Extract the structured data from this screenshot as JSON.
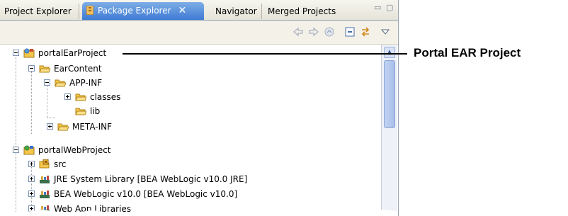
{
  "tabs": [
    {
      "label": "Project Explorer",
      "active": false
    },
    {
      "label": "Package Explorer",
      "active": true
    },
    {
      "label": "Navigator",
      "active": false
    },
    {
      "label": "Merged Projects",
      "active": false
    }
  ],
  "tab_close_glyph": "✕",
  "window_controls": {
    "minimize": "▭",
    "maximize": "▢"
  },
  "toolbar_icons": [
    "back-arrow-icon",
    "forward-arrow-icon",
    "home-icon",
    "collapse-all-icon",
    "link-with-editor-icon",
    "view-menu-icon"
  ],
  "tree": [
    {
      "label": "portalEarProject",
      "icon": "ear-project-icon",
      "expanded": true,
      "level": 0
    },
    {
      "label": "EarContent",
      "icon": "folder-open-icon",
      "expanded": true,
      "level": 1
    },
    {
      "label": "APP-INF",
      "icon": "folder-open-icon",
      "expanded": true,
      "level": 2
    },
    {
      "label": "classes",
      "icon": "folder-icon",
      "expanded": false,
      "level": 3
    },
    {
      "label": "lib",
      "icon": "folder-icon",
      "expanded": null,
      "level": 3
    },
    {
      "label": "META-INF",
      "icon": "folder-icon",
      "expanded": false,
      "level": 2
    },
    {
      "label": "portalWebProject",
      "icon": "web-project-icon",
      "expanded": true,
      "level": 0
    },
    {
      "label": "src",
      "icon": "source-folder-icon",
      "expanded": false,
      "level": 1
    },
    {
      "label": "JRE System Library [BEA WebLogic v10.0 JRE]",
      "icon": "library-icon",
      "expanded": false,
      "level": 1
    },
    {
      "label": "BEA WebLogic v10.0 [BEA WebLogic v10.0]",
      "icon": "library-icon",
      "expanded": false,
      "level": 1
    },
    {
      "label": "Web App Libraries",
      "icon": "library-icon",
      "expanded": false,
      "level": 1
    }
  ],
  "callout": {
    "label": "Portal EAR Project"
  },
  "colors": {
    "active_tab": "#3f7bd4",
    "folder": "#f4c64a",
    "library": "#3a6f4a"
  }
}
